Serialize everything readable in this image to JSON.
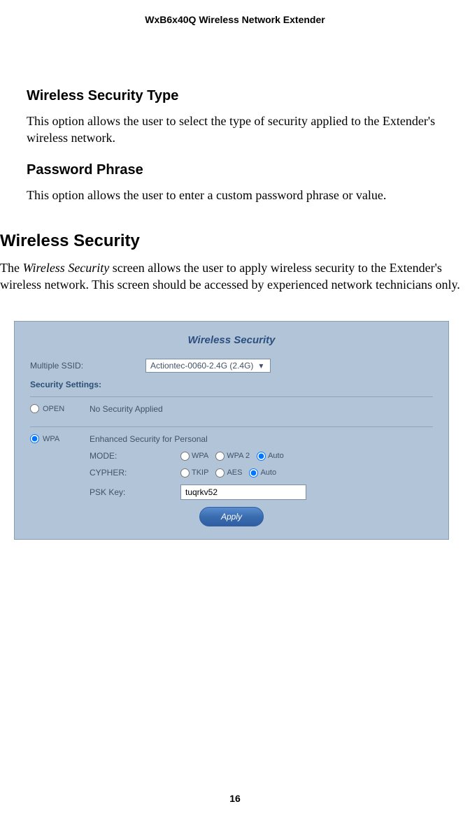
{
  "header": {
    "title": "WxB6x40Q Wireless Network Extender"
  },
  "sections": {
    "securityType": {
      "heading": "Wireless Security Type",
      "body": "This option allows the user to select the type of security applied to the Extender's wireless network."
    },
    "passwordPhrase": {
      "heading": "Password Phrase",
      "body": "This option allows the user to enter a custom password phrase or value."
    },
    "wirelessSecurity": {
      "heading": "Wireless Security",
      "body_prefix": "The ",
      "body_italic": "Wireless Security",
      "body_suffix": " screen allows the user to apply wireless security to the Extender's wireless network. This screen should be accessed by experienced network technicians only."
    }
  },
  "panel": {
    "title": "Wireless Security",
    "multipleSsidLabel": "Multiple SSID:",
    "ssidSelected": "Actiontec-0060-2.4G (2.4G)",
    "securitySettingsLabel": "Security Settings:",
    "open": {
      "label": "OPEN",
      "desc": "No Security Applied"
    },
    "wpa": {
      "label": "WPA",
      "desc": "Enhanced Security for Personal",
      "modeLabel": "MODE:",
      "modeOptions": {
        "wpa": "WPA",
        "wpa2": "WPA 2",
        "auto": "Auto"
      },
      "cypherLabel": "CYPHER:",
      "cypherOptions": {
        "tkip": "TKIP",
        "aes": "AES",
        "auto": "Auto"
      },
      "pskLabel": "PSK Key:",
      "pskValue": "tuqrkv52"
    },
    "applyLabel": "Apply"
  },
  "pageNumber": "16"
}
